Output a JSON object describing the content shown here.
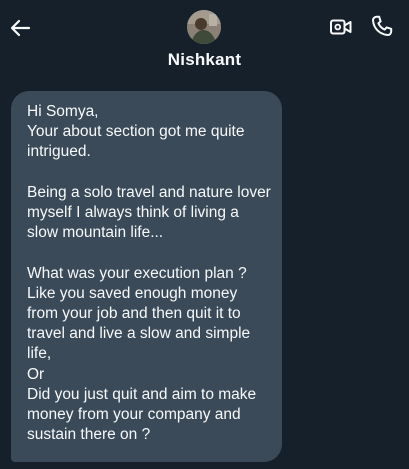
{
  "header": {
    "contact_name": "Nishkant",
    "back_icon": "arrow-left-icon",
    "video_icon": "video-call-icon",
    "call_icon": "phone-icon"
  },
  "message": {
    "paragraphs": [
      "Hi Somya,\nYour about section got me quite intrigued.",
      "Being a solo travel and nature lover myself I always think of living a slow mountain life...",
      "What was your execution plan ?\nLike you saved enough money from your job and then quit it to travel and live a slow and simple life,\nOr\nDid you just quit and aim to make money from your company and sustain there on ?"
    ]
  },
  "colors": {
    "background": "#15202b",
    "bubble": "#3b4a58",
    "text": "#f7f9f9",
    "muted": "#8b98a5"
  }
}
